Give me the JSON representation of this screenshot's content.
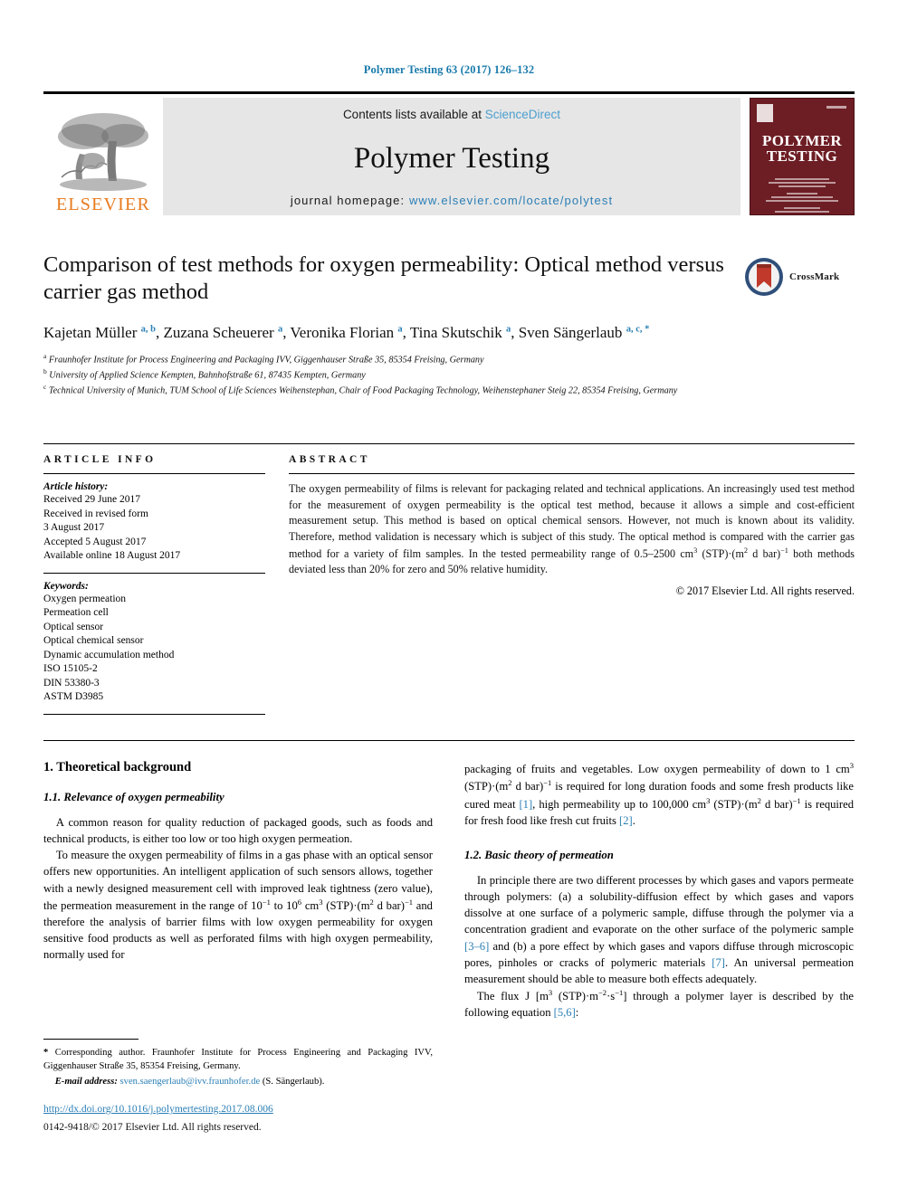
{
  "running_head": "Polymer Testing 63 (2017) 126–132",
  "masthead": {
    "publisher_name": "ELSEVIER",
    "contents_prefix": "Contents lists available at ",
    "contents_link": "ScienceDirect",
    "journal_title": "Polymer Testing",
    "homepage_prefix": "journal homepage: ",
    "homepage_url": "www.elsevier.com/locate/polytest",
    "cover_title_line1": "POLYMER",
    "cover_title_line2": "TESTING"
  },
  "article": {
    "title": "Comparison of test methods for oxygen permeability: Optical method versus carrier gas method",
    "crossmark_label": "CrossMark",
    "authors_html": "Kajetan Müller <sup>a, b</sup>, Zuzana Scheuerer <sup>a</sup>, Veronika Florian <sup>a</sup>, Tina Skutschik <sup>a</sup>, Sven Sängerlaub <sup>a, c, *</sup>",
    "affiliations": [
      {
        "mark": "a",
        "text": "Fraunhofer Institute for Process Engineering and Packaging IVV, Giggenhauser Straße 35, 85354 Freising, Germany"
      },
      {
        "mark": "b",
        "text": "University of Applied Science Kempten, Bahnhofstraße 61, 87435 Kempten, Germany"
      },
      {
        "mark": "c",
        "text": "Technical University of Munich, TUM School of Life Sciences Weihenstephan, Chair of Food Packaging Technology, Weihenstephaner Steig 22, 85354 Freising, Germany"
      }
    ]
  },
  "article_info": {
    "heading": "ARTICLE INFO",
    "history_label": "Article history:",
    "history": [
      "Received 29 June 2017",
      "Received in revised form",
      "3 August 2017",
      "Accepted 5 August 2017",
      "Available online 18 August 2017"
    ],
    "keywords_label": "Keywords:",
    "keywords": [
      "Oxygen permeation",
      "Permeation cell",
      "Optical sensor",
      "Optical chemical sensor",
      "Dynamic accumulation method",
      "ISO 15105-2",
      "DIN 53380-3",
      "ASTM D3985"
    ]
  },
  "abstract": {
    "heading": "ABSTRACT",
    "body_html": "The oxygen permeability of films is relevant for packaging related and technical applications. An increasingly used test method for the measurement of oxygen permeability is the optical test method, because it allows a simple and cost-efficient measurement setup. This method is based on optical chemical sensors. However, not much is known about its validity. Therefore, method validation is necessary which is subject of this study. The optical method is compared with the carrier gas method for a variety of film samples. In the tested permeability range of 0.5–2500 cm<sup class=\"sm\">3</sup> (STP)·(m<sup class=\"sm\">2</sup> d bar)<sup class=\"sm\">−1</sup> both methods deviated less than 20% for zero and 50% relative humidity.",
    "copyright": "© 2017 Elsevier Ltd. All rights reserved."
  },
  "body": {
    "section1_number_title": "1. Theoretical background",
    "sub11_title": "1.1. Relevance of oxygen permeability",
    "p1": "A common reason for quality reduction of packaged goods, such as foods and technical products, is either too low or too high oxygen permeation.",
    "p2_html": "To measure the oxygen permeability of films in a gas phase with an optical sensor offers new opportunities. An intelligent application of such sensors allows, together with a newly designed measurement cell with improved leak tightness (zero value), the permeation measurement in the range of 10<sup class=\"sm\">−1</sup> to 10<sup class=\"sm\">6</sup> cm<sup class=\"sm\">3</sup> (STP)·(m<sup class=\"sm\">2</sup> d bar)<sup class=\"sm\">−1</sup> and therefore the analysis of barrier films with low oxygen permeability for oxygen sensitive food products as well as perforated films with high oxygen permeability, normally used for",
    "p2_cont_html": "packaging of fruits and vegetables. Low oxygen permeability of down to 1 cm<sup class=\"sm\">3</sup> (STP)·(m<sup class=\"sm\">2</sup> d bar)<sup class=\"sm\">−1</sup> is required for long duration foods and some fresh products like cured meat <span class=\"ref\">[1]</span>, high permeability up to 100,000 cm<sup class=\"sm\">3</sup> (STP)·(m<sup class=\"sm\">2</sup> d bar)<sup class=\"sm\">−1</sup> is required for fresh food like fresh cut fruits <span class=\"ref\">[2]</span>.",
    "sub12_title": "1.2. Basic theory of permeation",
    "p3_html": "In principle there are two different processes by which gases and vapors permeate through polymers: (a) a solubility-diffusion effect by which gases and vapors dissolve at one surface of a polymeric sample, diffuse through the polymer via a concentration gradient and evaporate on the other surface of the polymeric sample <span class=\"ref\">[3–6]</span> and (b) a pore effect by which gases and vapors diffuse through microscopic pores, pinholes or cracks of polymeric materials <span class=\"ref\">[7]</span>. An universal permeation measurement should be able to measure both effects adequately.",
    "p4_html": "The flux J [m<sup class=\"sm\">3</sup> (STP)·m<sup class=\"sm\">−2</sup>·s<sup class=\"sm\">−1</sup>] through a polymer layer is described by the following equation <span class=\"ref\">[5,6]</span>:"
  },
  "footer": {
    "corresponding_html": "<b>*</b> Corresponding author. Fraunhofer Institute for Process Engineering and Packaging IVV, Giggenhauser Straße 35, 85354 Freising, Germany.",
    "email_label": "E-mail address:",
    "email": "sven.saengerlaub@ivv.fraunhofer.de",
    "email_suffix": "(S. Sängerlaub).",
    "doi": "http://dx.doi.org/10.1016/j.polymertesting.2017.08.006",
    "issn_line": "0142-9418/© 2017 Elsevier Ltd. All rights reserved."
  },
  "colors": {
    "link_blue": "#2b7fb5",
    "sciencedirect_blue": "#4c9fce",
    "elsevier_orange": "#e87b1e",
    "cover_maroon": "#6d1d24"
  }
}
